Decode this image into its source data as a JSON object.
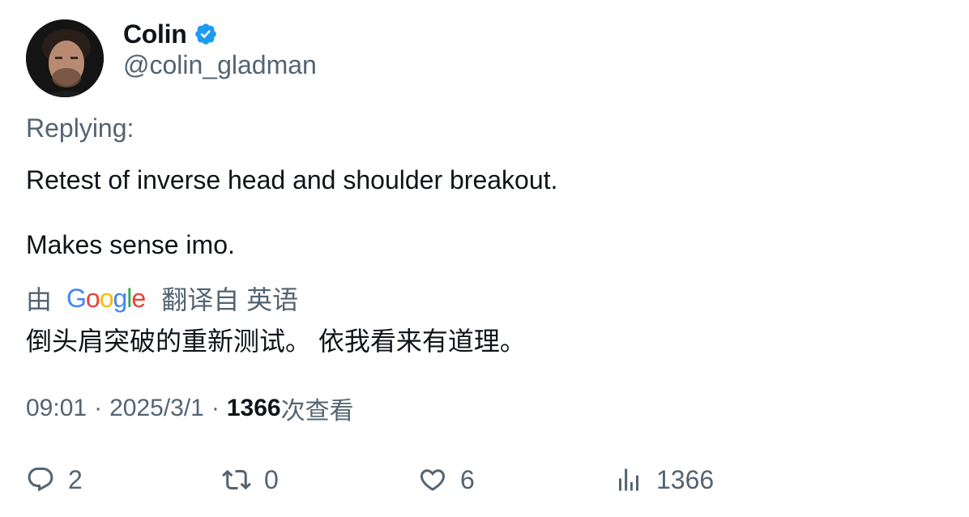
{
  "author": {
    "display_name": "Colin",
    "handle": "@colin_gladman",
    "verified": true
  },
  "replying_label": "Replying:",
  "tweet": {
    "lines": [
      "Retest of inverse head and shoulder breakout.",
      "Makes sense imo."
    ]
  },
  "translation": {
    "by_label": "由",
    "provider_logo_text": "Google",
    "translated_from_label": "翻译自 英语",
    "text": "倒头肩突破的重新测试。 依我看来有道理。"
  },
  "meta": {
    "time": "09:01",
    "separator": "·",
    "date": "2025/3/1",
    "views_count": "1366",
    "views_label": "次查看"
  },
  "actions": {
    "reply_count": "2",
    "retweet_count": "0",
    "like_count": "6",
    "views_count": "1366"
  },
  "colors": {
    "verified_badge": "#1d9bf0",
    "secondary_text": "#536471",
    "primary_text": "#0f1419",
    "google_blue": "#4285f4",
    "google_red": "#ea4335",
    "google_yellow": "#fbbc05",
    "google_green": "#34a853"
  },
  "icons": {
    "reply": "reply-icon",
    "retweet": "retweet-icon",
    "like": "heart-icon",
    "views": "analytics-icon",
    "verified": "verified-badge-icon"
  }
}
